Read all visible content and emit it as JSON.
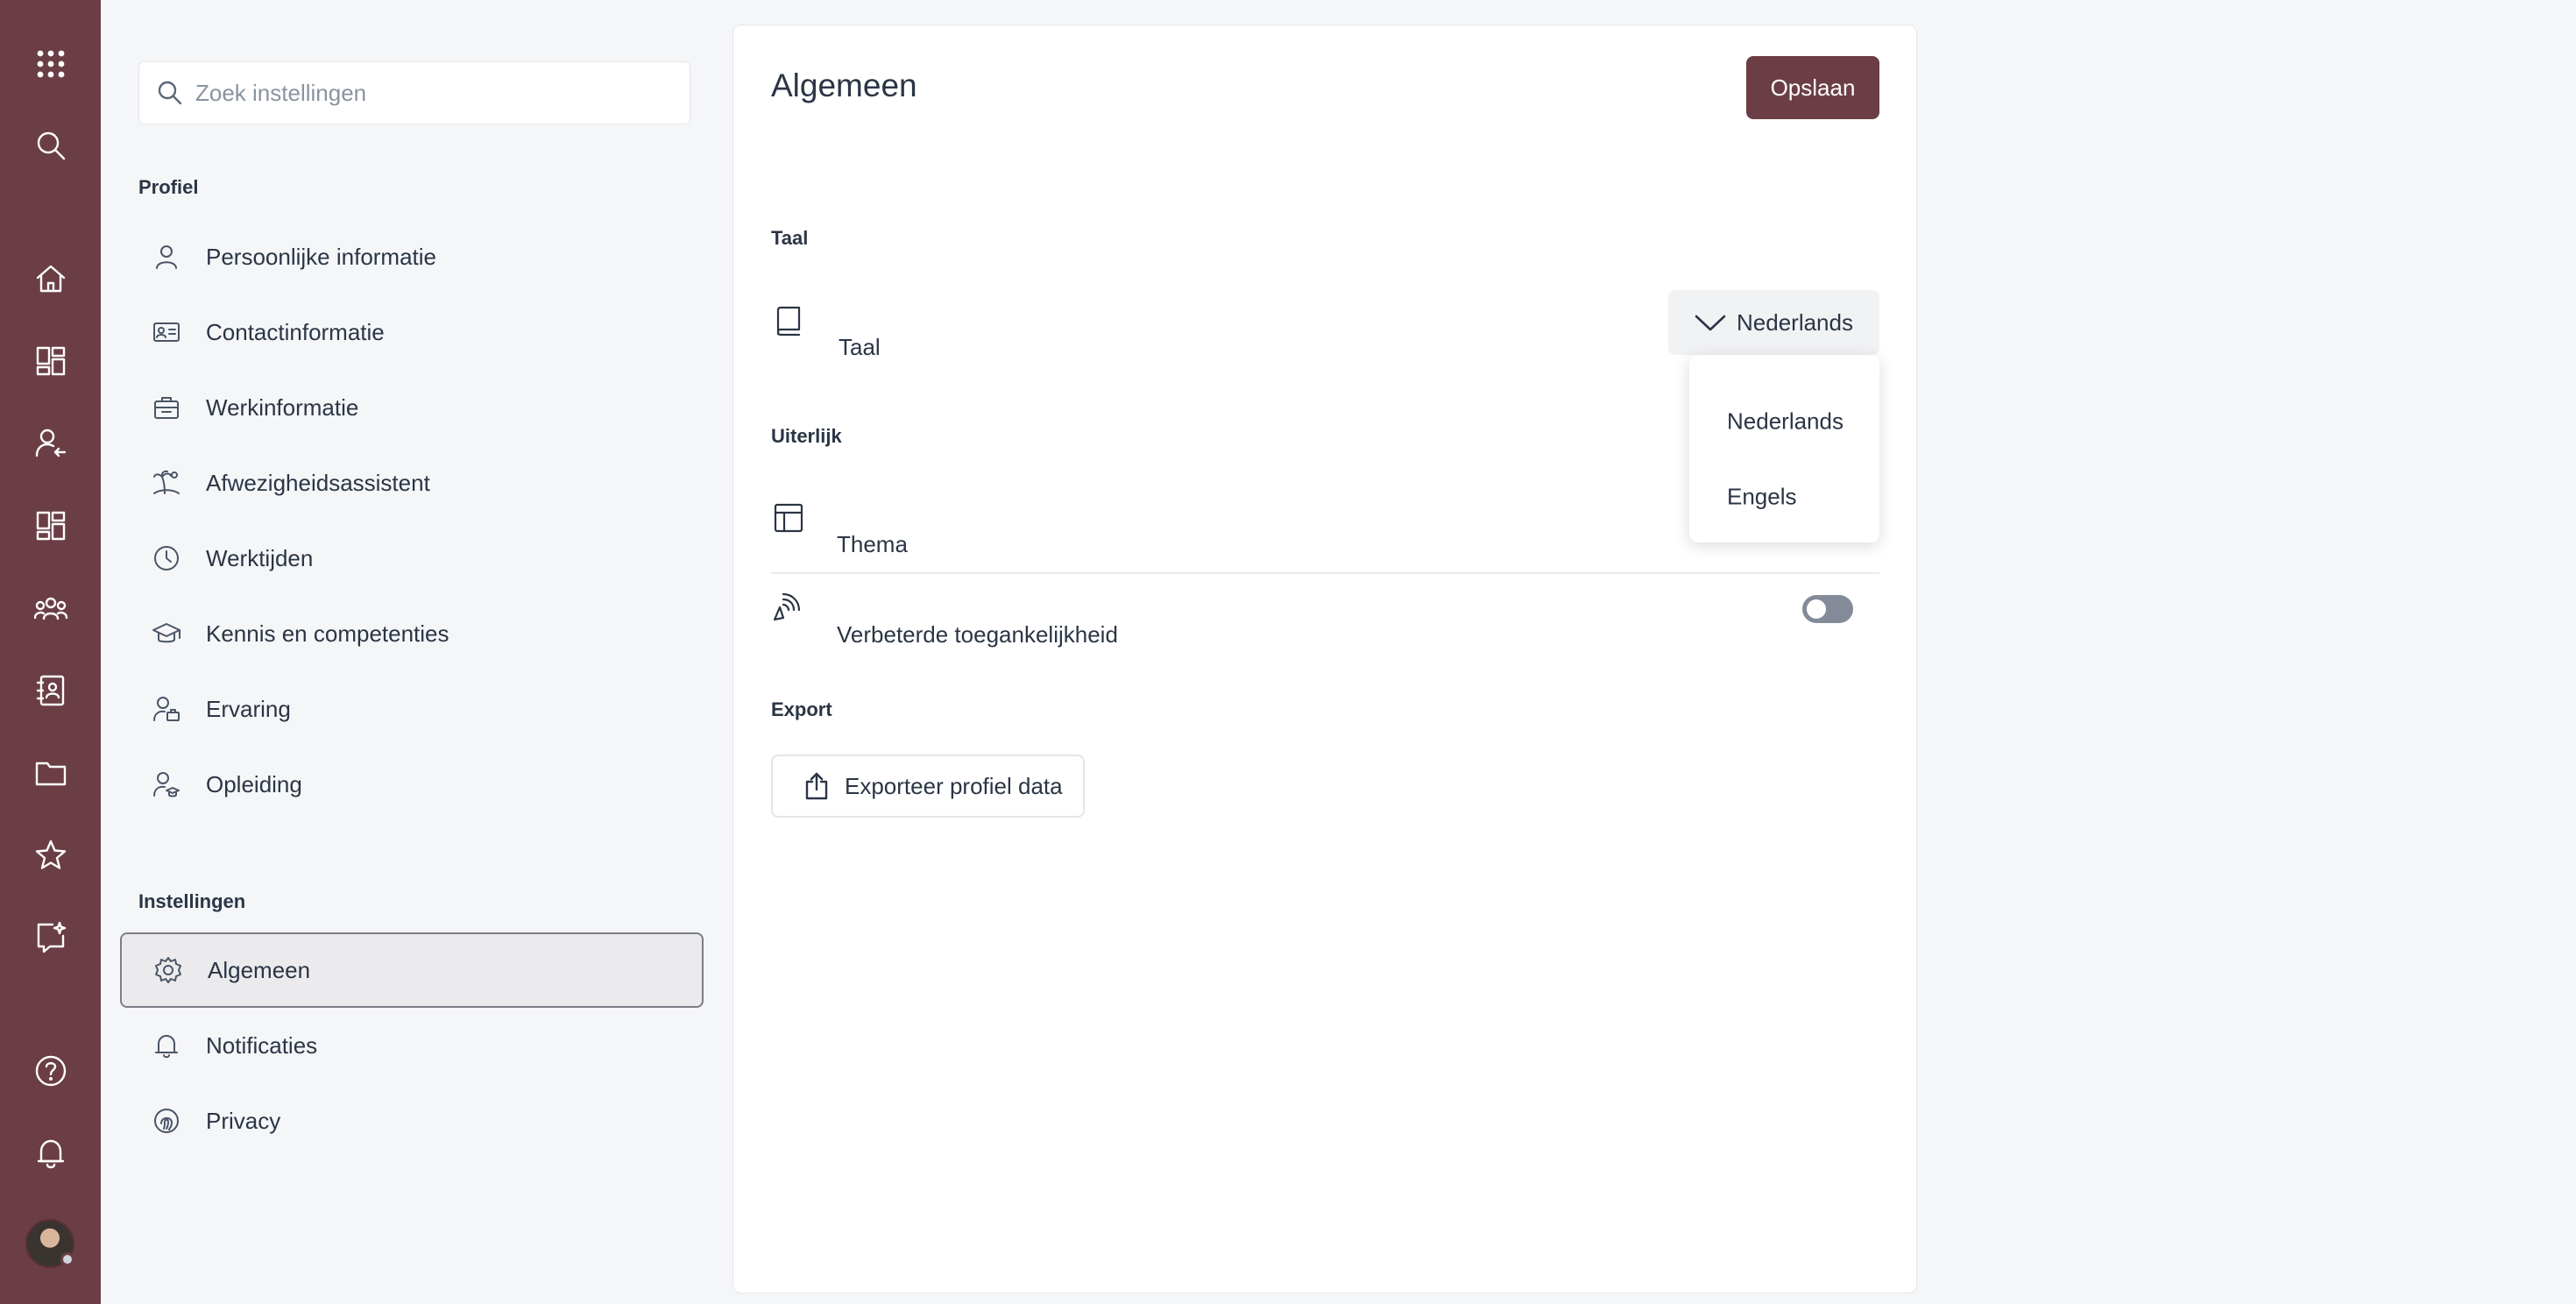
{
  "rail": {
    "top": [
      "apps-grid-icon",
      "search-icon"
    ],
    "items": [
      "home-icon",
      "dashboard-icon",
      "user-arrow-icon",
      "dashboard-icon",
      "team-icon",
      "contacts-book-icon",
      "folder-icon",
      "star-icon",
      "sparkle-message-icon"
    ],
    "bottom": [
      "help-icon",
      "bell-icon",
      "avatar"
    ]
  },
  "search": {
    "placeholder": "Zoek instellingen"
  },
  "nav": {
    "profile_title": "Profiel",
    "profile_items": [
      {
        "label": "Persoonlijke informatie",
        "icon": "person-icon"
      },
      {
        "label": "Contactinformatie",
        "icon": "id-card-icon"
      },
      {
        "label": "Werkinformatie",
        "icon": "briefcase-icon"
      },
      {
        "label": "Afwezigheidsassistent",
        "icon": "island-icon"
      },
      {
        "label": "Werktijden",
        "icon": "clock-icon"
      },
      {
        "label": "Kennis en competenties",
        "icon": "graduation-cap-icon"
      },
      {
        "label": "Ervaring",
        "icon": "person-briefcase-icon"
      },
      {
        "label": "Opleiding",
        "icon": "person-cap-icon"
      }
    ],
    "settings_title": "Instellingen",
    "settings_items": [
      {
        "label": "Algemeen",
        "icon": "gear-icon",
        "active": true
      },
      {
        "label": "Notificaties",
        "icon": "bell-icon"
      },
      {
        "label": "Privacy",
        "icon": "fingerprint-icon"
      }
    ]
  },
  "main": {
    "title": "Algemeen",
    "save_label": "Opslaan",
    "language_section": "Taal",
    "language_label": "Taal",
    "language_value": "Nederlands",
    "language_options": [
      "Nederlands",
      "Engels"
    ],
    "appearance_section": "Uiterlijk",
    "theme_label": "Thema",
    "accessibility_label": "Verbeterde toegankelijkheid",
    "accessibility_enabled": false,
    "export_section": "Export",
    "export_label": "Exporteer profiel data"
  },
  "colors": {
    "rail": "#6b3e46",
    "primary_button": "#6b3e46",
    "toggle_off": "#848b98"
  }
}
